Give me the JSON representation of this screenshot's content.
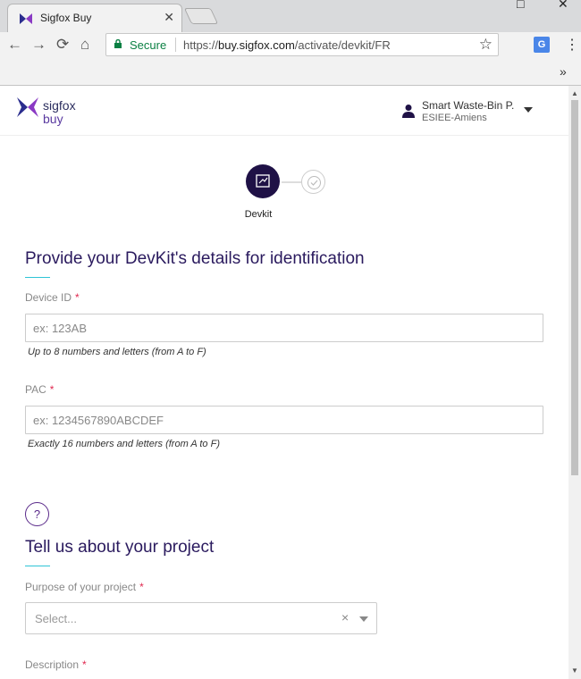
{
  "browser": {
    "tab_title": "Sigfox Buy",
    "tab_close": "✕",
    "win_minimize": "—",
    "win_maximize": "□",
    "win_close": "✕",
    "back": "←",
    "forward": "→",
    "reload": "⟳",
    "home": "⌂",
    "secure_label": "Secure",
    "url_scheme": "https://",
    "url_host": "buy.sigfox.com",
    "url_path": "/activate/devkit/FR",
    "star": "☆",
    "menu": "⋮",
    "bookmarks_chevron": "»"
  },
  "header": {
    "logo_line1": "sigfox",
    "logo_line2": "buy",
    "user_name": "Smart Waste-Bin P.",
    "user_org": "ESIEE-Amiens"
  },
  "stepper": {
    "step1_label": "Devkit",
    "accent_color": "#1f1146"
  },
  "devkit_section": {
    "title": "Provide your DevKit's details for identification",
    "device_id": {
      "label": "Device ID",
      "required_mark": "*",
      "placeholder": "ex: 123AB",
      "hint": "Up to 8 numbers and letters (from A to F)"
    },
    "pac": {
      "label": "PAC",
      "required_mark": "*",
      "placeholder": "ex: 1234567890ABCDEF",
      "hint": "Exactly 16 numbers and letters (from A to F)"
    }
  },
  "project_section": {
    "help_icon": "?",
    "title": "Tell us about your project",
    "purpose": {
      "label": "Purpose of your project",
      "required_mark": "*",
      "placeholder": "Select...",
      "clear": "×"
    },
    "description": {
      "label": "Description",
      "required_mark": "*"
    }
  }
}
